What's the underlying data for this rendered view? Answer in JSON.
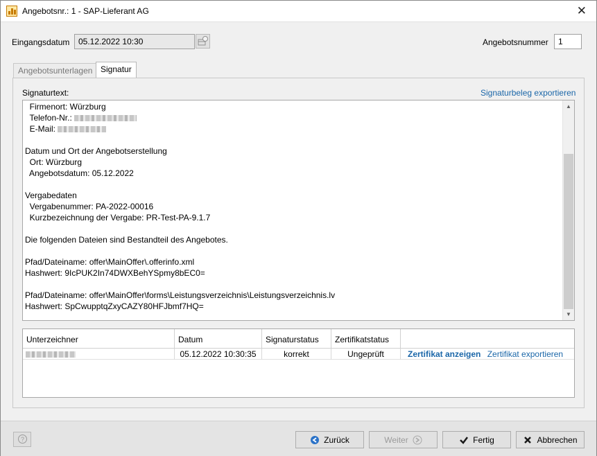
{
  "window": {
    "title": "Angebotsnr.: 1 - SAP-Lieferant AG",
    "close_glyph": "✕"
  },
  "header": {
    "eingangsdatum_label": "Eingangsdatum",
    "eingangsdatum_value": "05.12.2022 10:30",
    "angebotsnummer_label": "Angebotsnummer",
    "angebotsnummer_value": "1"
  },
  "tabs": [
    {
      "label": "Angebotsunterlagen",
      "active": false
    },
    {
      "label": "Signatur",
      "active": true
    }
  ],
  "signatur": {
    "text_label": "Signaturtext:",
    "export_link": "Signaturbeleg exportieren",
    "lines": [
      "  Firmenort: Würzburg",
      "  Telefon-Nr.: ",
      "  E-Mail: ",
      "",
      "Datum und Ort der Angebotserstellung",
      "  Ort: Würzburg",
      "  Angebotsdatum: 05.12.2022",
      "",
      "Vergabedaten",
      "  Vergabenummer: PA-2022-00016",
      "  Kurzbezeichnung der Vergabe: PR-Test-PA-9.1.7",
      "",
      "Die folgenden Dateien sind Bestandteil des Angebotes.",
      "",
      "Pfad/Dateiname: offer\\MainOffer\\.offerinfo.xml",
      "Hashwert: 9IcPUK2In74DWXBehYSpmy8bEC0=",
      "",
      "Pfad/Dateiname: offer\\MainOffer\\forms\\Leistungsverzeichnis\\Leistungsverzeichnis.lv",
      "Hashwert: SpCwupptqZxyCAZY80HFJbmf7HQ="
    ]
  },
  "table": {
    "headers": [
      "Unterzeichner",
      "Datum",
      "Signaturstatus",
      "Zertifikatstatus"
    ],
    "rows": [
      {
        "datum": "05.12.2022 10:30:35",
        "signaturstatus": "korrekt",
        "zertifikatstatus": "Ungeprüft",
        "link_show": "Zertifikat anzeigen",
        "link_export": "Zertifikat exportieren"
      }
    ]
  },
  "footer": {
    "back": "Zurück",
    "next": "Weiter",
    "finish": "Fertig",
    "cancel": "Abbrechen",
    "help_glyph": "?"
  },
  "colors": {
    "link": "#1a66a8",
    "back_icon": "#2a72c8"
  }
}
